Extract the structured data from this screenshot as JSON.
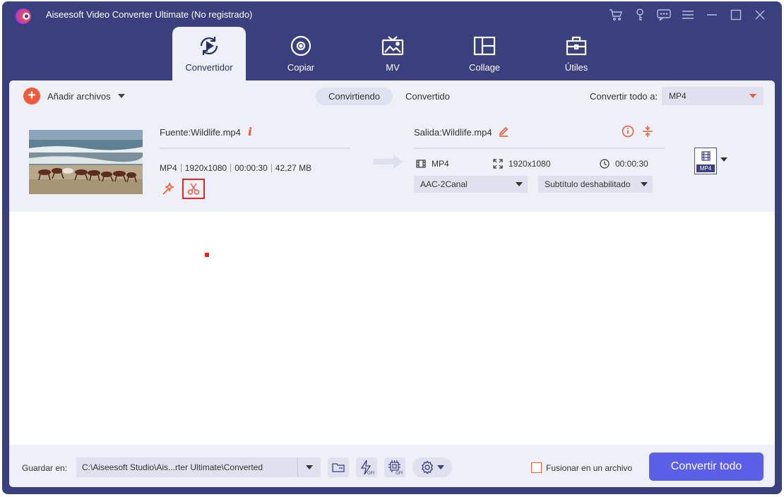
{
  "app": {
    "title": "Aiseesoft Video Converter Ultimate (No registrado)"
  },
  "window_controls": [
    "cart-icon",
    "key-icon",
    "feedback-icon",
    "menu-icon",
    "minimize-icon",
    "maximize-icon",
    "close-icon"
  ],
  "tabs": [
    {
      "label": "Convertidor",
      "icon": "convert-icon",
      "active": true
    },
    {
      "label": "Copiar",
      "icon": "disc-icon",
      "active": false
    },
    {
      "label": "MV",
      "icon": "mv-icon",
      "active": false
    },
    {
      "label": "Collage",
      "icon": "collage-icon",
      "active": false
    },
    {
      "label": "Útiles",
      "icon": "toolbox-icon",
      "active": false
    }
  ],
  "toolbar": {
    "add_files_label": "Añadir archivos",
    "segments": [
      {
        "label": "Convirtiendo",
        "active": true
      },
      {
        "label": "Convertido",
        "active": false
      }
    ],
    "convert_all_to_label": "Convertir todo a:",
    "convert_all_to_value": "MP4"
  },
  "file": {
    "source_name": "Fuente:Wildlife.mp4",
    "source_meta": [
      "MP4",
      "1920x1080",
      "00:00:30",
      "42,27 MB"
    ],
    "output_name": "Salida:Wildlife.mp4",
    "output_format": "MP4",
    "output_resolution": "1920x1080",
    "output_duration": "00:00:30",
    "audio_track": "AAC-2Canal",
    "subtitle": "Subtítulo deshabilitado",
    "format_badge": "MP4"
  },
  "footer": {
    "save_label": "Guardar en:",
    "save_path": "C:\\Aiseesoft Studio\\Ais...rter Ultimate\\Converted",
    "merge_label": "Fusionar en un archivo",
    "merge_checked": false,
    "convert_all_button": "Convertir todo"
  },
  "colors": {
    "accent": "#f05a3a",
    "window": "#3a3f7d",
    "primary_button": "#5b5ee6",
    "highlight": "#e02626"
  }
}
